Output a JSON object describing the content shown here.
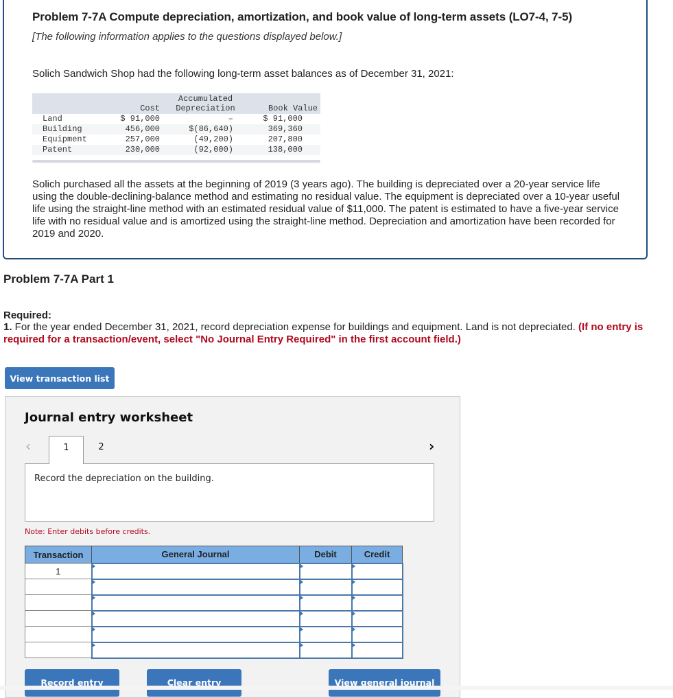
{
  "problem": {
    "title": "Problem 7-7A Compute depreciation, amortization, and book value of long-term assets (LO7-4, 7-5)",
    "info_note": "[The following information applies to the questions displayed below.]",
    "intro": "Solich Sandwich Shop had the following long-term asset balances as of December 31, 2021:",
    "asset_table": {
      "headers": {
        "cost": "Cost",
        "accum_line1": "Accumulated",
        "accum_line2": "Depreciation",
        "book": "Book Value"
      },
      "rows": [
        {
          "label": "Land",
          "cost": "$ 91,000",
          "accum": "–",
          "book": "$ 91,000"
        },
        {
          "label": "Building",
          "cost": "456,000",
          "accum": "$(86,640)",
          "book": "369,360"
        },
        {
          "label": "Equipment",
          "cost": "257,000",
          "accum": "(49,200)",
          "book": "207,800"
        },
        {
          "label": "Patent",
          "cost": "230,000",
          "accum": "(92,000)",
          "book": "138,000"
        }
      ]
    },
    "description": "Solich purchased all the assets at the beginning of 2019 (3 years ago). The building is depreciated over a 20-year service life using the double-declining-balance method and estimating no residual value. The equipment is depreciated over a 10-year useful life using the straight-line method with an estimated residual value of $11,000. The patent is estimated to have a five-year service life with no residual value and is amortized using the straight-line method. Depreciation and amortization have been recorded for 2019 and 2020."
  },
  "part": {
    "title": "Problem 7-7A Part 1",
    "required_label": "Required:",
    "required_num": "1.",
    "required_text": " For the year ended December 31, 2021, record depreciation expense for buildings and equipment. Land is not depreciated. ",
    "required_red": "(If no entry is required for a transaction/event, select \"No Journal Entry Required\" in the first account field.)",
    "view_transaction_list_label": "View transaction list"
  },
  "worksheet": {
    "title": "Journal entry worksheet",
    "prev_icon": "‹",
    "next_icon": "›",
    "tabs": [
      {
        "label": "1",
        "active": true
      },
      {
        "label": "2",
        "active": false
      }
    ],
    "prompt": "Record the depreciation on the building.",
    "note": "Note: Enter debits before credits.",
    "table": {
      "headers": [
        "Transaction",
        "General Journal",
        "Debit",
        "Credit"
      ],
      "rows": [
        {
          "transaction": "1",
          "account": "",
          "debit": "",
          "credit": ""
        },
        {
          "transaction": "",
          "account": "",
          "debit": "",
          "credit": ""
        },
        {
          "transaction": "",
          "account": "",
          "debit": "",
          "credit": ""
        },
        {
          "transaction": "",
          "account": "",
          "debit": "",
          "credit": ""
        },
        {
          "transaction": "",
          "account": "",
          "debit": "",
          "credit": ""
        },
        {
          "transaction": "",
          "account": "",
          "debit": "",
          "credit": ""
        }
      ]
    },
    "buttons": {
      "record": "Record entry",
      "clear": "Clear entry",
      "view_general_journal": "View general journal"
    }
  },
  "colors": {
    "accent_blue": "#3b76bb",
    "header_blue": "#7aaee3",
    "warning_red": "#b0091d",
    "frame_border": "#1f4e79"
  }
}
